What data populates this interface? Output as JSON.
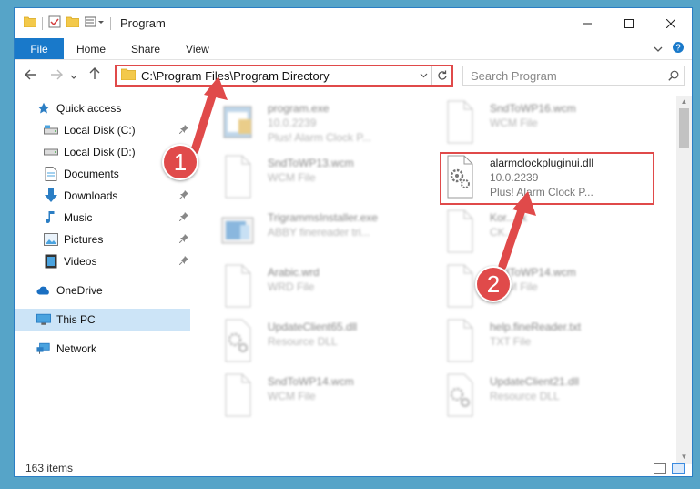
{
  "window": {
    "title": "Program"
  },
  "ribbon": {
    "tabs": [
      "File",
      "Home",
      "Share",
      "View"
    ]
  },
  "address": {
    "path": "C:\\Program Files\\Program Directory"
  },
  "search": {
    "placeholder": "Search Program"
  },
  "sidebar": {
    "items": [
      {
        "label": "Quick access",
        "icon": "star-icon",
        "pinned": false
      },
      {
        "label": "Local Disk (C:)",
        "icon": "drive-icon",
        "pinned": true
      },
      {
        "label": "Local Disk (D:)",
        "icon": "drive-icon",
        "pinned": false
      },
      {
        "label": "Documents",
        "icon": "documents-icon",
        "pinned": true
      },
      {
        "label": "Downloads",
        "icon": "downloads-icon",
        "pinned": true
      },
      {
        "label": "Music",
        "icon": "music-icon",
        "pinned": true
      },
      {
        "label": "Pictures",
        "icon": "pictures-icon",
        "pinned": true
      },
      {
        "label": "Videos",
        "icon": "videos-icon",
        "pinned": true
      },
      {
        "label": "OneDrive",
        "icon": "onedrive-icon",
        "pinned": false
      },
      {
        "label": "This PC",
        "icon": "this-pc-icon",
        "pinned": false
      },
      {
        "label": "Network",
        "icon": "network-icon",
        "pinned": false
      }
    ]
  },
  "files": [
    {
      "name": "program.exe",
      "line2": "10.0.2239",
      "line3": "Plus! Alarm Clock P...",
      "kind": "exe"
    },
    {
      "name": "SndToWP16.wcm",
      "line2": "WCM File",
      "line3": "",
      "kind": "doc"
    },
    {
      "name": "SndToWP13.wcm",
      "line2": "WCM File",
      "line3": "",
      "kind": "doc"
    },
    {
      "name": "alarmclockpluginui.dll",
      "line2": "10.0.2239",
      "line3": "Plus! Alarm Clock P...",
      "kind": "dll"
    },
    {
      "name": "TrigrammsInstaller.exe",
      "line2": "ABBY finereader tri...",
      "line3": "",
      "kind": "installer"
    },
    {
      "name": "Kor...gk",
      "line2": "CK...",
      "line3": "",
      "kind": "doc"
    },
    {
      "name": "Arabic.wrd",
      "line2": "WRD File",
      "line3": "",
      "kind": "doc"
    },
    {
      "name": "SndToWP14.wcm",
      "line2": "WCM File",
      "line3": "",
      "kind": "doc"
    },
    {
      "name": "UpdateClient65.dll",
      "line2": "Resource DLL",
      "line3": "",
      "kind": "dll"
    },
    {
      "name": "help.fineReader.txt",
      "line2": "TXT File",
      "line3": "",
      "kind": "doc"
    },
    {
      "name": "SndToWP14.wcm",
      "line2": "WCM File",
      "line3": "",
      "kind": "doc"
    },
    {
      "name": "UpdateClient21.dll",
      "line2": "Resource DLL",
      "line3": "",
      "kind": "dll"
    }
  ],
  "status": {
    "count": "163 items"
  },
  "callouts": [
    "1",
    "2"
  ],
  "colors": {
    "accent": "#1979ca",
    "highlight": "#e04a4a",
    "selected": "#cce4f7"
  }
}
